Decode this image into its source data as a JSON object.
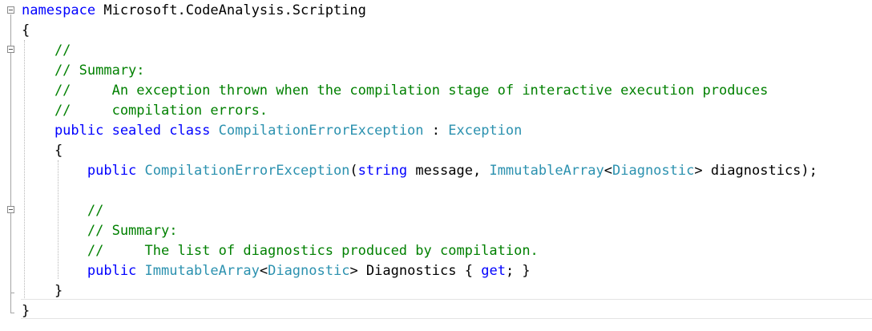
{
  "editor": {
    "lines": [
      [
        {
          "t": "kw",
          "v": "namespace"
        },
        {
          "t": "tx",
          "v": " Microsoft.CodeAnalysis.Scripting"
        }
      ],
      [
        {
          "t": "tx",
          "v": "{"
        }
      ],
      [
        {
          "t": "cm",
          "v": "    //"
        }
      ],
      [
        {
          "t": "cm",
          "v": "    // Summary:"
        }
      ],
      [
        {
          "t": "cm",
          "v": "    //     An exception thrown when the compilation stage of interactive execution produces"
        }
      ],
      [
        {
          "t": "cm",
          "v": "    //     compilation errors."
        }
      ],
      [
        {
          "t": "kw",
          "v": "    public sealed class"
        },
        {
          "t": "tx",
          "v": " "
        },
        {
          "t": "ty",
          "v": "CompilationErrorException"
        },
        {
          "t": "tx",
          "v": " : "
        },
        {
          "t": "ty",
          "v": "Exception"
        }
      ],
      [
        {
          "t": "tx",
          "v": "    {"
        }
      ],
      [
        {
          "t": "kw",
          "v": "        public"
        },
        {
          "t": "tx",
          "v": " "
        },
        {
          "t": "ty",
          "v": "CompilationErrorException"
        },
        {
          "t": "tx",
          "v": "("
        },
        {
          "t": "kw",
          "v": "string"
        },
        {
          "t": "tx",
          "v": " message, "
        },
        {
          "t": "ty",
          "v": "ImmutableArray"
        },
        {
          "t": "tx",
          "v": "<"
        },
        {
          "t": "ty",
          "v": "Diagnostic"
        },
        {
          "t": "tx",
          "v": "> diagnostics);"
        }
      ],
      [
        {
          "t": "tx",
          "v": ""
        }
      ],
      [
        {
          "t": "cm",
          "v": "        //"
        }
      ],
      [
        {
          "t": "cm",
          "v": "        // Summary:"
        }
      ],
      [
        {
          "t": "cm",
          "v": "        //     The list of diagnostics produced by compilation."
        }
      ],
      [
        {
          "t": "kw",
          "v": "        public"
        },
        {
          "t": "tx",
          "v": " "
        },
        {
          "t": "ty",
          "v": "ImmutableArray"
        },
        {
          "t": "tx",
          "v": "<"
        },
        {
          "t": "ty",
          "v": "Diagnostic"
        },
        {
          "t": "tx",
          "v": "> Diagnostics { "
        },
        {
          "t": "kw",
          "v": "get"
        },
        {
          "t": "tx",
          "v": "; }"
        }
      ],
      [
        {
          "t": "tx",
          "v": "    }"
        }
      ],
      [
        {
          "t": "tx",
          "v": "}"
        }
      ]
    ]
  },
  "colors": {
    "keyword": "#0000ff",
    "type": "#2b91af",
    "comment": "#008000",
    "text": "#000000"
  },
  "icons": {
    "fold": "collapse-minus-icon"
  }
}
